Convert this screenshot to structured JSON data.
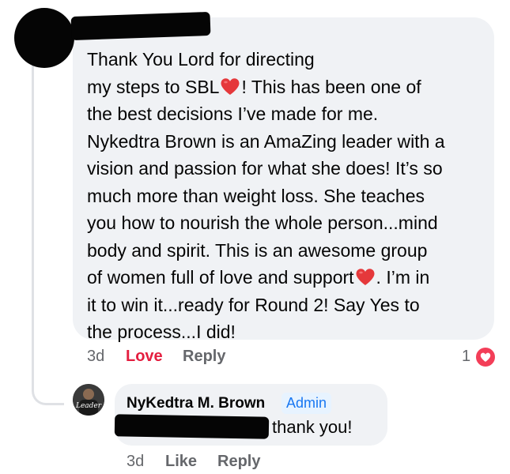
{
  "comment": {
    "lines": [
      "Thank You Lord for  directing",
      "my steps to SBL",
      "! This has been one of",
      "the best decisions I’ve made for me.",
      "Nykedtra Brown is an AmaZing leader with a",
      "vision and passion for what she does! It’s so",
      "much more than weight loss. She teaches",
      "you how to nourish the whole person...mind",
      "body and spirit. This is an awesome group",
      "of women full of love and support",
      ". I’m in",
      "it to win it...ready for Round 2! Say Yes to",
      "the process...I did!"
    ],
    "time": "3d",
    "love_label": "Love",
    "reply_label": "Reply",
    "reaction_count": "1"
  },
  "reply": {
    "author": "NyKedtra M. Brown",
    "badge": "Admin",
    "text": "thank you!",
    "time": "3d",
    "like_label": "Like",
    "reply_label": "Reply",
    "avatar_text": "Leader"
  },
  "colors": {
    "bubble": "#f0f2f5",
    "love": "#e41e3f",
    "meta": "#65676b",
    "badge_text": "#1877f2",
    "badge_bg": "#e7f3ff",
    "heart": "#f33e58"
  },
  "icons": [
    "heart-emoji-icon",
    "love-reaction-icon"
  ]
}
